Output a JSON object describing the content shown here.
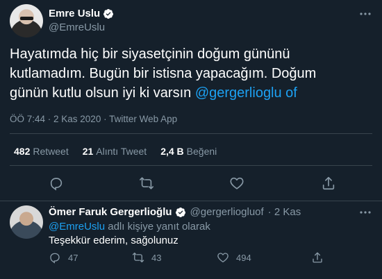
{
  "tweet": {
    "author_name": "Emre Uslu",
    "author_handle": "@EmreUslu",
    "text_lines": [
      "Hayatımda hiç bir siyasetçinin doğum gününü",
      "kutlamadım. Bugün bir istisna yapacağım. Doğum",
      "günün kutlu olsun iyi ki varsın "
    ],
    "mention": "@gergerlioglu of",
    "meta": "ÖÖ 7:44 · 2 Kas 2020 · Twitter Web App",
    "stats": {
      "retweets_count": "482",
      "retweets_label": "Retweet",
      "quotes_count": "21",
      "quotes_label": "Alıntı Tweet",
      "likes_count": "2,4 B",
      "likes_label": "Beğeni"
    }
  },
  "reply": {
    "author_name": "Ömer Faruk Gergerlioğlu",
    "author_handle": "@gergerliogluof",
    "time": "· 2 Kas",
    "replying_to_mention": "@EmreUslu",
    "replying_to_suffix": " adlı kişiye yanıt olarak",
    "text": "Teşekkür ederim, sağolunuz",
    "reply_count": "47",
    "retweet_count": "43",
    "like_count": "494"
  },
  "colors": {
    "background": "#15202b",
    "accent": "#1da1f2",
    "muted": "#8899a6",
    "divider": "#38444d"
  },
  "icons": [
    "verified-badge-icon",
    "more-icon",
    "reply-icon",
    "retweet-icon",
    "like-icon",
    "share-icon"
  ]
}
